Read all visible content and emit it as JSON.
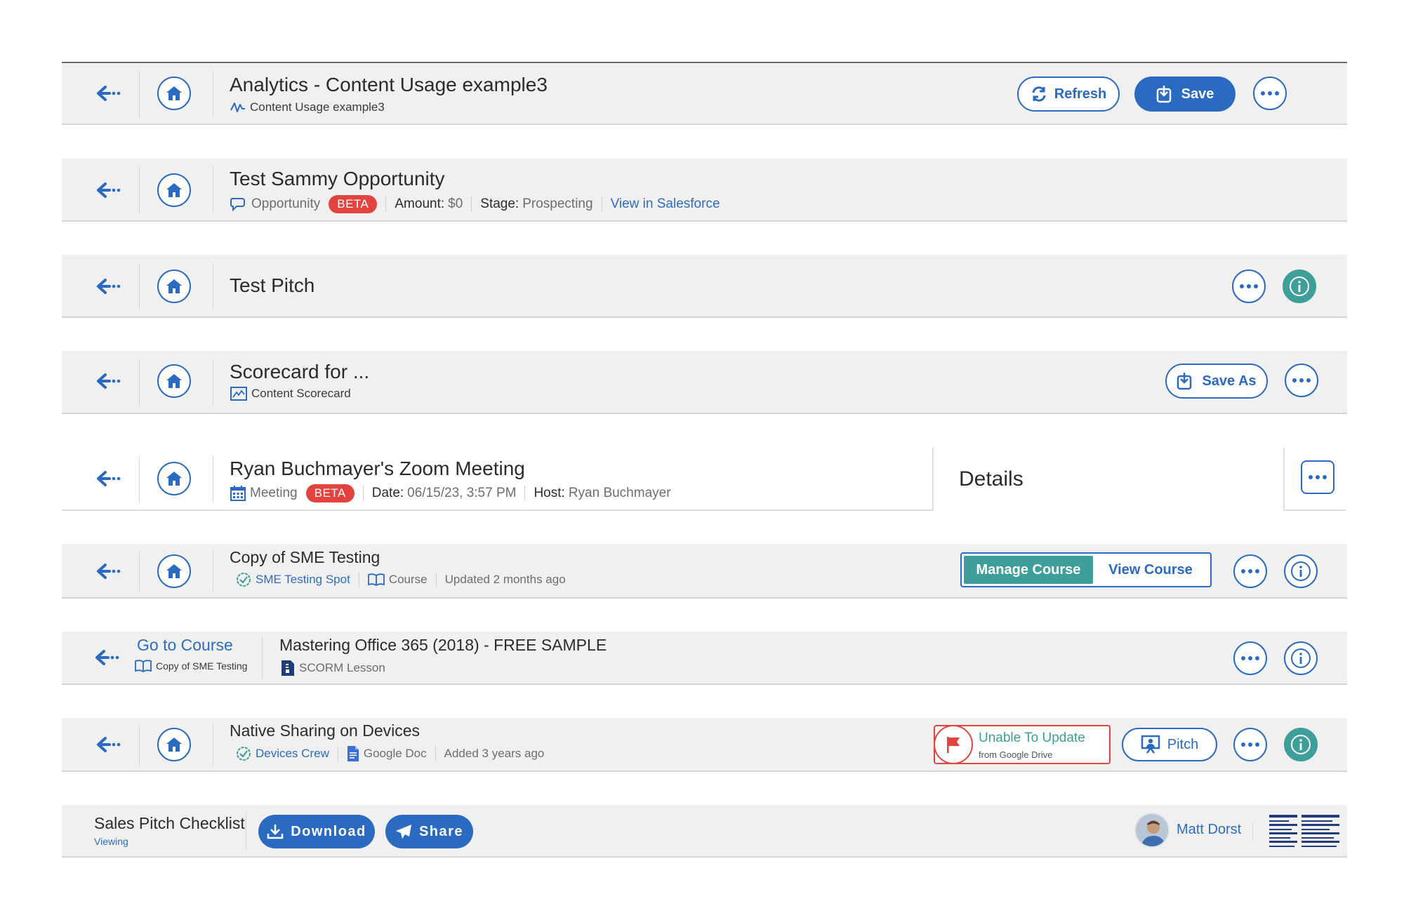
{
  "colors": {
    "accent": "#2a6ac0",
    "teal": "#3e9e9a",
    "badge": "#e2433f",
    "bar_bg": "#f0f0f0"
  },
  "analytics": {
    "title": "Analytics - Content Usage example3",
    "subtitle": "Content Usage example3",
    "refresh_label": "Refresh",
    "save_label": "Save"
  },
  "opportunity": {
    "title": "Test Sammy Opportunity",
    "type": "Opportunity",
    "badge": "BETA",
    "amount_key": "Amount:",
    "amount_value": "$0",
    "stage_key": "Stage:",
    "stage_value": "Prospecting",
    "link": "View in Salesforce"
  },
  "pitch": {
    "title": "Test Pitch"
  },
  "scorecard": {
    "title": "Scorecard for ...",
    "subtitle": "Content Scorecard",
    "save_as_label": "Save As"
  },
  "meeting": {
    "title": "Ryan Buchmayer's Zoom Meeting",
    "type": "Meeting",
    "badge": "BETA",
    "date_key": "Date:",
    "date_value": "06/15/23, 3:57 PM",
    "host_key": "Host:",
    "host_value": "Ryan Buchmayer",
    "details_label": "Details"
  },
  "course": {
    "title": "Copy of SME Testing",
    "spot": "SME Testing Spot",
    "type": "Course",
    "updated": "Updated 2 months ago",
    "manage_label": "Manage Course",
    "view_label": "View Course"
  },
  "lesson": {
    "back_link": "Go to Course",
    "back_sub": "Copy of SME Testing",
    "title": "Mastering Office 365 (2018) - FREE SAMPLE",
    "type": "SCORM Lesson"
  },
  "native": {
    "title": "Native Sharing on Devices",
    "crew": "Devices Crew",
    "type": "Google Doc",
    "added": "Added 3 years ago",
    "warn_title": "Unable To Update",
    "warn_sub": "from Google Drive",
    "pitch_label": "Pitch"
  },
  "checklist": {
    "title": "Sales Pitch Checklist",
    "status": "Viewing",
    "download_label": "Download",
    "share_label": "Share",
    "user": "Matt Dorst"
  }
}
